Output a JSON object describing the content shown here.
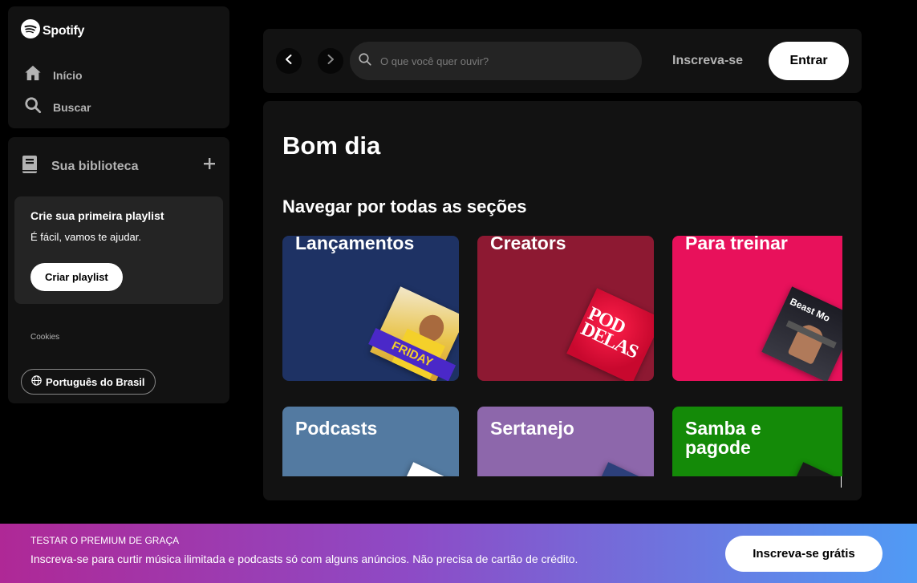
{
  "brand": {
    "name": "Spotify"
  },
  "sidebar": {
    "nav": [
      {
        "label": "Início",
        "icon": "home-icon"
      },
      {
        "label": "Buscar",
        "icon": "search-icon"
      }
    ],
    "library": {
      "label": "Sua biblioteca",
      "promo": {
        "title": "Crie sua primeira playlist",
        "subtitle": "É fácil, vamos te ajudar.",
        "button": "Criar playlist"
      },
      "cookies": "Cookies",
      "language": "Português do Brasil"
    }
  },
  "topbar": {
    "search_placeholder": "O que você quer ouvir?",
    "signup": "Inscreva-se",
    "login": "Entrar"
  },
  "main": {
    "greeting": "Bom dia",
    "section_title": "Navegar por todas as seções",
    "tiles": [
      {
        "name": "Lançamentos",
        "color": "#1e3264",
        "art_text": "FRIDAY"
      },
      {
        "name": "Creators",
        "color": "#8d1932",
        "art_text": "POD DELAS"
      },
      {
        "name": "Para treinar",
        "color": "#e8115b",
        "art_text": "Beast Mo"
      },
      {
        "name": "Podcasts",
        "color": "#537aa1",
        "art_text": ""
      },
      {
        "name": "Sertanejo",
        "color": "#8d67ab",
        "art_text": ""
      },
      {
        "name": "Samba e pagode",
        "color": "#148a08",
        "art_text": ""
      }
    ]
  },
  "banner": {
    "title": "TESTAR O PREMIUM DE GRAÇA",
    "text": "Inscreva-se para curtir música ilimitada e podcasts só com alguns anúncios. Não precisa de cartão de crédito.",
    "button": "Inscreva-se grátis"
  }
}
